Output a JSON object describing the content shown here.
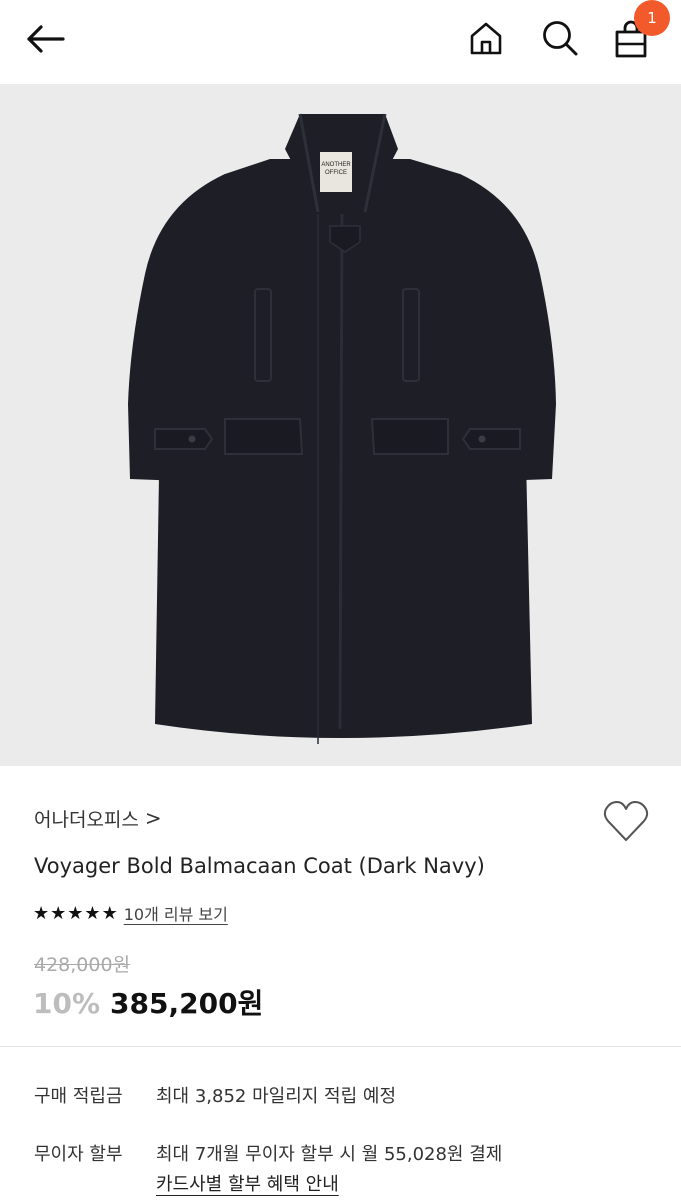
{
  "header": {
    "back_icon": "arrow-left-icon",
    "home_icon": "home-icon",
    "search_icon": "search-icon",
    "cart_icon": "shopping-bag-icon",
    "cart_count": "1"
  },
  "product_image": {
    "alt": "Voyager Bold Balmacaan Coat (Dark Navy)",
    "background": "#ebebeb",
    "coat_color": "#1d1e26",
    "label_line1": "ANOTHER",
    "label_line2": "OFFICE"
  },
  "product": {
    "brand": "어나더오피스",
    "brand_chevron": ">",
    "name": "Voyager Bold Balmacaan Coat (Dark Navy)",
    "stars": [
      "★",
      "★",
      "★",
      "★",
      "★"
    ],
    "review_link": "10개 리뷰 보기",
    "original_price": "428,000원",
    "discount": "10%",
    "price": "385,200원"
  },
  "info": {
    "points_label": "구매 적립금",
    "points_value": "최대 3,852 마일리지 적립 예정",
    "installment_label": "무이자 할부",
    "installment_value": "최대 7개월 무이자 할부 시 월 55,028원 결제",
    "card_benefit_link": "카드사별 할부 혜택 안내"
  },
  "colors": {
    "badge": "#f2592b",
    "discount": "#bdbdbd"
  }
}
